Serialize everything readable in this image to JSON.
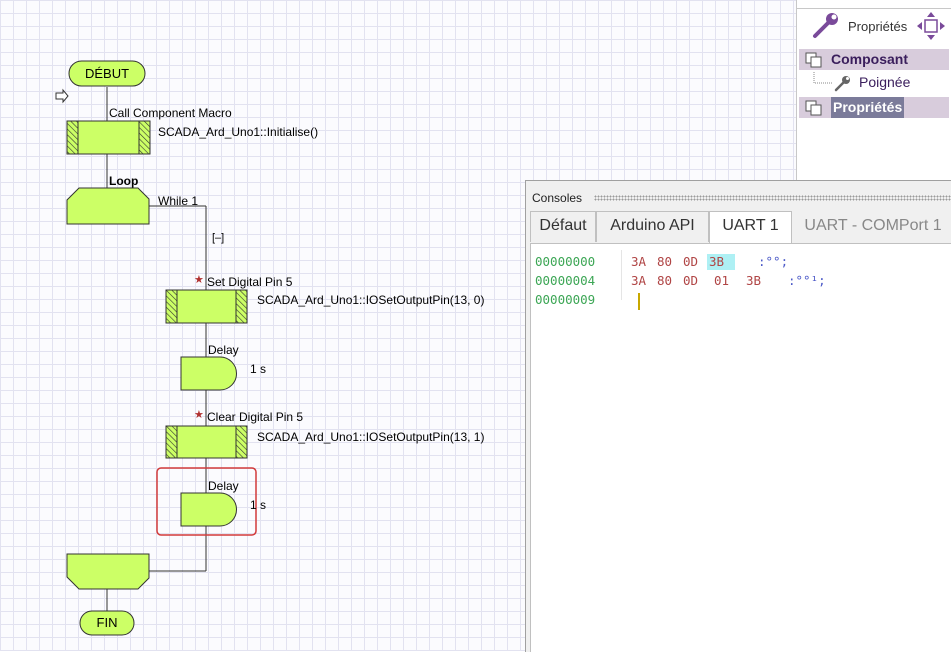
{
  "flowchart": {
    "start_label": "DÉBUT",
    "end_label": "FIN",
    "call_macro": {
      "title": "Call Component Macro",
      "detail": "SCADA_Ard_Uno1::Initialise()"
    },
    "loop": {
      "title": "Loop",
      "condition": "While 1",
      "collapse_glyph": "[–]"
    },
    "set_pin": {
      "title": "Set Digital Pin 5",
      "detail": "SCADA_Ard_Uno1::IOSetOutputPin(13, 0)"
    },
    "delay1": {
      "title": "Delay",
      "value": "1 s"
    },
    "clear_pin": {
      "title": "Clear Digital Pin 5",
      "detail": "SCADA_Ard_Uno1::IOSetOutputPin(13, 1)"
    },
    "delay2": {
      "title": "Delay",
      "value": "1 s"
    },
    "colors": {
      "block_fill": "#ccff66",
      "block_stroke": "#333333",
      "selection": "#d23a3a"
    }
  },
  "properties_panel": {
    "toolbar_label": "Propriétés",
    "tree": {
      "component": "Composant",
      "handle": "Poignée",
      "properties": "Propriétés"
    }
  },
  "consoles": {
    "title": "Consoles",
    "tabs": [
      "Défaut",
      "Arduino API",
      "UART 1",
      "UART - COMPort 1"
    ],
    "active_tab": "UART 1",
    "rows": [
      {
        "addr": "00000000",
        "bytes": [
          "3A",
          "80",
          "0D",
          "3B"
        ],
        "ascii": ":°°;"
      },
      {
        "addr": "00000004",
        "bytes": [
          "3A",
          "80",
          "0D",
          "01",
          "3B"
        ],
        "ascii": ":°°¹;"
      },
      {
        "addr": "00000009",
        "bytes": [],
        "ascii": ""
      }
    ]
  }
}
